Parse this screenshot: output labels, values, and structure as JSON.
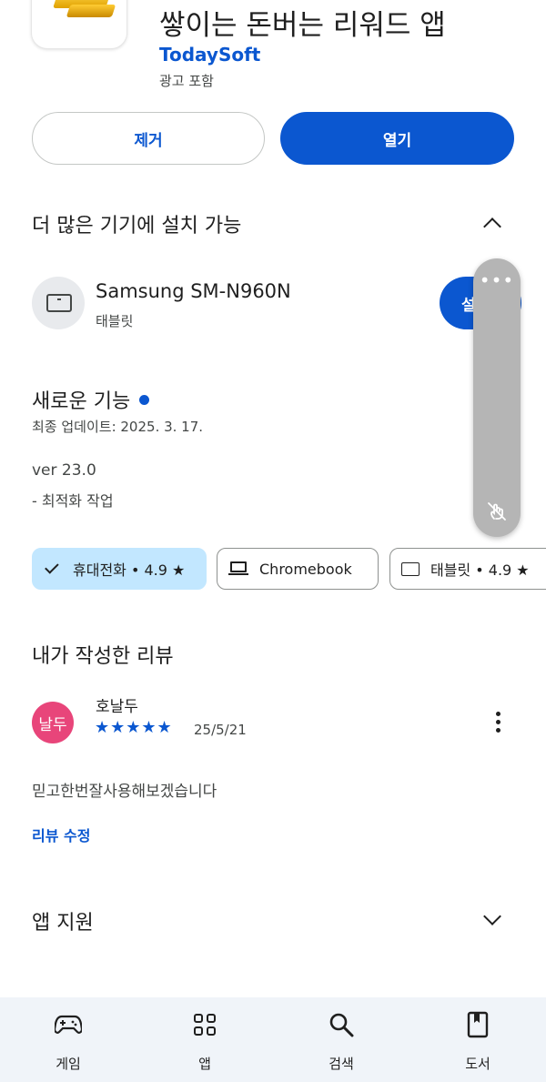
{
  "app": {
    "title": "쌓이는 돈버는 리워드 앱",
    "developer": "TodaySoft",
    "ads_note": "광고 포함",
    "icon": "gold-bars-icon"
  },
  "actions": {
    "uninstall_label": "제거",
    "open_label": "열기"
  },
  "devices_section": {
    "title": "더 많은 기기에 설치 가능",
    "device_name": "Samsung SM-N960N",
    "device_type": "태블릿",
    "install_label_partial": "설"
  },
  "whats_new": {
    "title": "새로운 기능",
    "updated": "최종 업데이트: 2025. 3. 17.",
    "version": "ver 23.0",
    "note": "- 최적화 작업"
  },
  "chips": [
    {
      "label": "휴대전화 • 4.9 ★",
      "selected": true
    },
    {
      "label": "Chromebook",
      "selected": false
    },
    {
      "label": "태블릿 • 4.9 ★",
      "selected": false
    }
  ],
  "my_review": {
    "title": "내가 작성한 리뷰",
    "avatar_text": "날두",
    "avatar_color": "#e8457a",
    "reviewer": "호날두",
    "stars": "★★★★★",
    "rating": 5,
    "date": "25/5/21",
    "text": "믿고한번잘사용해보겠습니다",
    "edit_label": "리뷰 수정"
  },
  "support": {
    "title": "앱 지원"
  },
  "bottom_nav": [
    {
      "label": "게임",
      "icon": "gamepad-icon"
    },
    {
      "label": "앱",
      "icon": "apps-grid-icon"
    },
    {
      "label": "검색",
      "icon": "search-icon"
    },
    {
      "label": "도서",
      "icon": "book-icon"
    }
  ],
  "colors": {
    "accent": "#0b57d0",
    "chip_selected": "#c2e7ff",
    "nav_bg": "#f0f4f9"
  }
}
